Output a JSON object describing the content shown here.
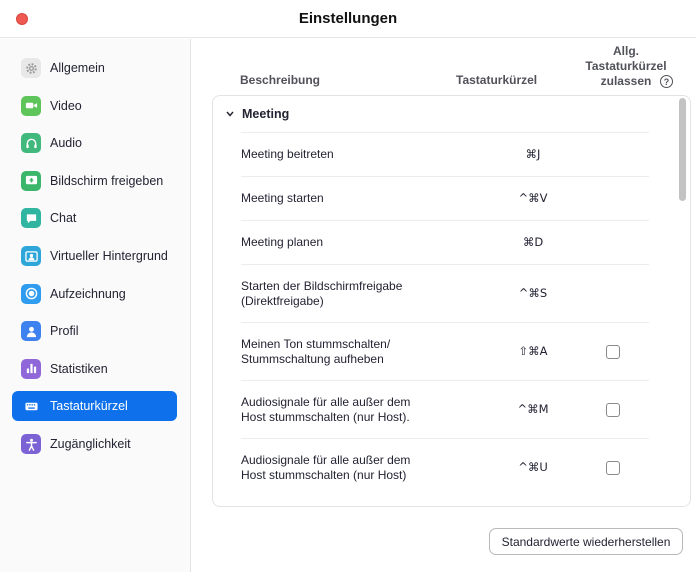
{
  "window": {
    "title": "Einstellungen"
  },
  "sidebar": {
    "items": [
      {
        "label": "Allgemein",
        "icon": "gear-icon",
        "color": "#e8e8e8",
        "active": false
      },
      {
        "label": "Video",
        "icon": "video-camera-icon",
        "color": "#5ec55b",
        "active": false
      },
      {
        "label": "Audio",
        "icon": "headphones-icon",
        "color": "#41b87c",
        "active": false
      },
      {
        "label": "Bildschirm freigeben",
        "icon": "share-screen-icon",
        "color": "#3bb66a",
        "active": false
      },
      {
        "label": "Chat",
        "icon": "chat-bubble-icon",
        "color": "#2fb5a0",
        "active": false
      },
      {
        "label": "Virtueller Hintergrund",
        "icon": "virtual-background-icon",
        "color": "#2ea6d9",
        "active": false
      },
      {
        "label": "Aufzeichnung",
        "icon": "record-icon",
        "color": "#2f9cf0",
        "active": false
      },
      {
        "label": "Profil",
        "icon": "profile-icon",
        "color": "#3d82ef",
        "active": false
      },
      {
        "label": "Statistiken",
        "icon": "bar-chart-icon",
        "color": "#8f67d9",
        "active": false
      },
      {
        "label": "Tastaturkürzel",
        "icon": "keyboard-icon",
        "color": "#0e71eb",
        "active": true
      },
      {
        "label": "Zugänglichkeit",
        "icon": "accessibility-icon",
        "color": "#7b63d6",
        "active": false
      }
    ]
  },
  "table": {
    "col_description": "Beschreibung",
    "col_shortcut": "Tastaturkürzel",
    "col_allow_line1": "Allg.",
    "col_allow_line2": "Tastaturkürzel",
    "col_allow_line3": "zulassen",
    "help": "?",
    "group_title": "Meeting",
    "rows": [
      {
        "desc_line1": "Meeting beitreten",
        "desc_line2": "",
        "shortcut": "⌘J",
        "checkbox": false,
        "checked": false
      },
      {
        "desc_line1": "Meeting starten",
        "desc_line2": "",
        "shortcut": "^⌘V",
        "checkbox": false,
        "checked": false
      },
      {
        "desc_line1": "Meeting planen",
        "desc_line2": "",
        "shortcut": "⌘D",
        "checkbox": false,
        "checked": false
      },
      {
        "desc_line1": "Starten der Bildschirmfreigabe",
        "desc_line2": "(Direktfreigabe)",
        "shortcut": "^⌘S",
        "checkbox": false,
        "checked": false
      },
      {
        "desc_line1": "Meinen Ton stummschalten/",
        "desc_line2": "Stummschaltung aufheben",
        "shortcut": "⇧⌘A",
        "checkbox": true,
        "checked": false
      },
      {
        "desc_line1": "Audiosignale für alle außer dem",
        "desc_line2": "Host stummschalten (nur Host).",
        "shortcut": "^⌘M",
        "checkbox": true,
        "checked": false
      },
      {
        "desc_line1": "Audiosignale für alle außer dem",
        "desc_line2": "Host stummschalten (nur Host)",
        "shortcut": "^⌘U",
        "checkbox": true,
        "checked": false
      }
    ]
  },
  "footer": {
    "reset_label": "Standardwerte wiederherstellen"
  }
}
